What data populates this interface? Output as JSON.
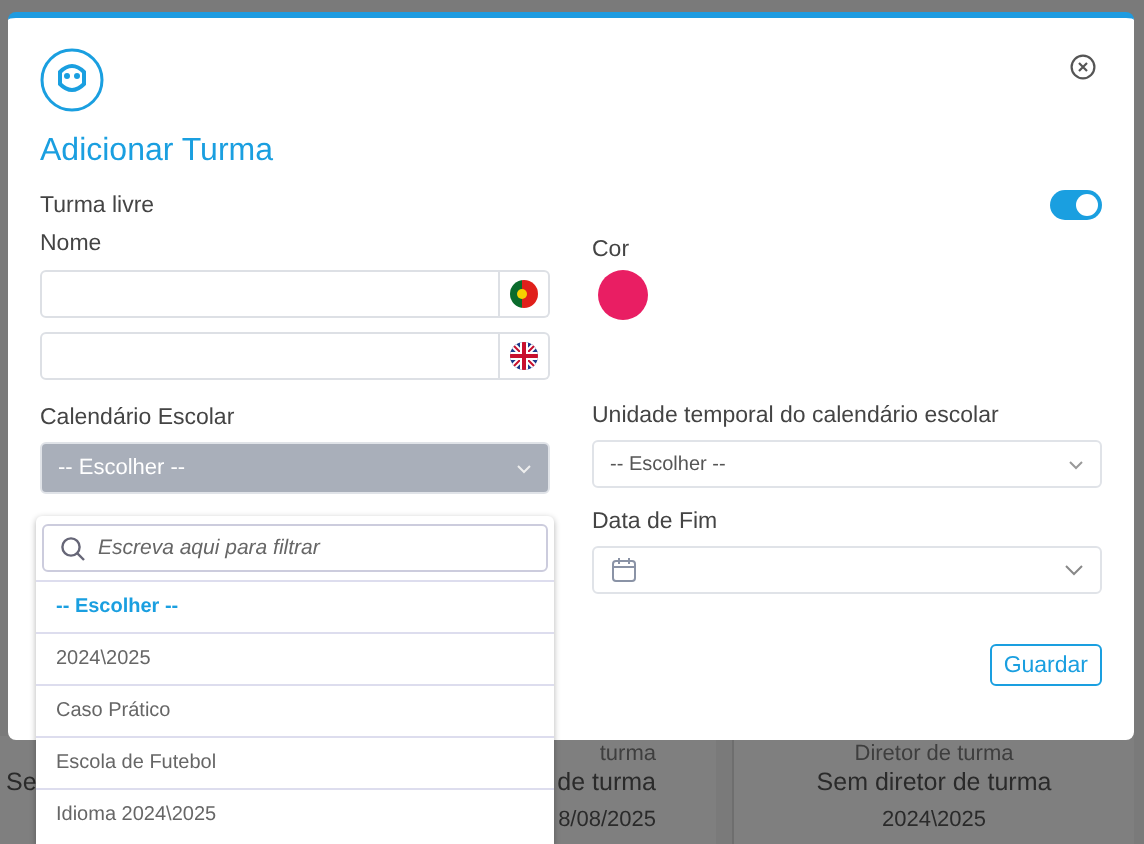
{
  "background_cards": [
    {
      "lines": [
        "Se"
      ]
    },
    {
      "lines": [
        "turma",
        "de turma",
        "8/08/2025"
      ]
    },
    {
      "lines": [
        "Diretor de turma",
        "Sem diretor de turma",
        "2024\\2025"
      ]
    }
  ],
  "dialog": {
    "title": "Adicionar Turma",
    "free_class": {
      "label": "Turma livre",
      "on": true
    },
    "name": {
      "label": "Nome",
      "fields": [
        {
          "kind": "pt"
        },
        {
          "kind": "gb"
        }
      ]
    },
    "color": {
      "label": "Cor",
      "color": "#e91e63"
    },
    "calendar": {
      "label": "Calendário Escolar",
      "value": "-- Escolher --",
      "expanded": true,
      "filter_placeholder": "Escreva aqui para filtrar",
      "options": [
        {
          "label": "-- Escolher --",
          "selected": true
        },
        {
          "label": "2024\\2025",
          "selected": false
        },
        {
          "label": "Caso Prático",
          "selected": false
        },
        {
          "label": "Escola de Futebol",
          "selected": false
        },
        {
          "label": "Idioma 2024\\2025",
          "selected": false
        }
      ]
    },
    "time_unit": {
      "label": "Unidade temporal do calendário escolar",
      "value": "-- Escolher --"
    },
    "end_date": {
      "label": "Data de Fim"
    },
    "save_button": "Guardar"
  }
}
